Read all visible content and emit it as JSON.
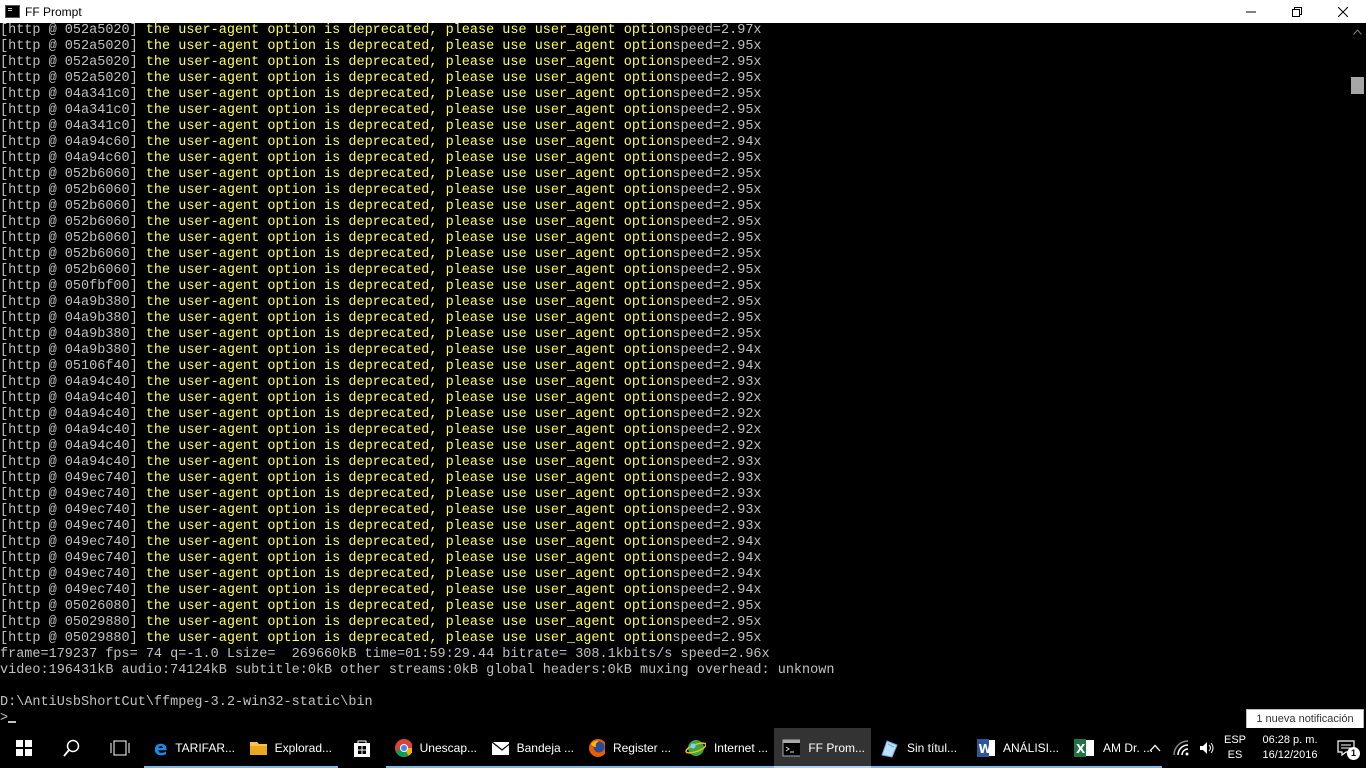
{
  "window": {
    "title": "FF Prompt",
    "controls": {
      "minimize": "1",
      "restore": "❐",
      "close": "✕"
    }
  },
  "console": {
    "log_lines": [
      {
        "addr": "[http @ 052a5020] ",
        "msg": "the user-agent option is deprecated, please use user_agent option",
        "speed": "speed=2.97x"
      },
      {
        "addr": "[http @ 052a5020] ",
        "msg": "the user-agent option is deprecated, please use user_agent option",
        "speed": "speed=2.95x"
      },
      {
        "addr": "[http @ 052a5020] ",
        "msg": "the user-agent option is deprecated, please use user_agent option",
        "speed": "speed=2.95x"
      },
      {
        "addr": "[http @ 052a5020] ",
        "msg": "the user-agent option is deprecated, please use user_agent option",
        "speed": "speed=2.95x"
      },
      {
        "addr": "[http @ 04a341c0] ",
        "msg": "the user-agent option is deprecated, please use user_agent option",
        "speed": "speed=2.95x"
      },
      {
        "addr": "[http @ 04a341c0] ",
        "msg": "the user-agent option is deprecated, please use user_agent option",
        "speed": "speed=2.95x"
      },
      {
        "addr": "[http @ 04a341c0] ",
        "msg": "the user-agent option is deprecated, please use user_agent option",
        "speed": "speed=2.95x"
      },
      {
        "addr": "[http @ 04a94c60] ",
        "msg": "the user-agent option is deprecated, please use user_agent option",
        "speed": "speed=2.94x"
      },
      {
        "addr": "[http @ 04a94c60] ",
        "msg": "the user-agent option is deprecated, please use user_agent option",
        "speed": "speed=2.95x"
      },
      {
        "addr": "[http @ 052b6060] ",
        "msg": "the user-agent option is deprecated, please use user_agent option",
        "speed": "speed=2.95x"
      },
      {
        "addr": "[http @ 052b6060] ",
        "msg": "the user-agent option is deprecated, please use user_agent option",
        "speed": "speed=2.95x"
      },
      {
        "addr": "[http @ 052b6060] ",
        "msg": "the user-agent option is deprecated, please use user_agent option",
        "speed": "speed=2.95x"
      },
      {
        "addr": "[http @ 052b6060] ",
        "msg": "the user-agent option is deprecated, please use user_agent option",
        "speed": "speed=2.95x"
      },
      {
        "addr": "[http @ 052b6060] ",
        "msg": "the user-agent option is deprecated, please use user_agent option",
        "speed": "speed=2.95x"
      },
      {
        "addr": "[http @ 052b6060] ",
        "msg": "the user-agent option is deprecated, please use user_agent option",
        "speed": "speed=2.95x"
      },
      {
        "addr": "[http @ 052b6060] ",
        "msg": "the user-agent option is deprecated, please use user_agent option",
        "speed": "speed=2.95x"
      },
      {
        "addr": "[http @ 050fbf00] ",
        "msg": "the user-agent option is deprecated, please use user_agent option",
        "speed": "speed=2.95x"
      },
      {
        "addr": "[http @ 04a9b380] ",
        "msg": "the user-agent option is deprecated, please use user_agent option",
        "speed": "speed=2.95x"
      },
      {
        "addr": "[http @ 04a9b380] ",
        "msg": "the user-agent option is deprecated, please use user_agent option",
        "speed": "speed=2.95x"
      },
      {
        "addr": "[http @ 04a9b380] ",
        "msg": "the user-agent option is deprecated, please use user_agent option",
        "speed": "speed=2.95x"
      },
      {
        "addr": "[http @ 04a9b380] ",
        "msg": "the user-agent option is deprecated, please use user_agent option",
        "speed": "speed=2.94x"
      },
      {
        "addr": "[http @ 05106f40] ",
        "msg": "the user-agent option is deprecated, please use user_agent option",
        "speed": "speed=2.94x"
      },
      {
        "addr": "[http @ 04a94c40] ",
        "msg": "the user-agent option is deprecated, please use user_agent option",
        "speed": "speed=2.93x"
      },
      {
        "addr": "[http @ 04a94c40] ",
        "msg": "the user-agent option is deprecated, please use user_agent option",
        "speed": "speed=2.92x"
      },
      {
        "addr": "[http @ 04a94c40] ",
        "msg": "the user-agent option is deprecated, please use user_agent option",
        "speed": "speed=2.92x"
      },
      {
        "addr": "[http @ 04a94c40] ",
        "msg": "the user-agent option is deprecated, please use user_agent option",
        "speed": "speed=2.92x"
      },
      {
        "addr": "[http @ 04a94c40] ",
        "msg": "the user-agent option is deprecated, please use user_agent option",
        "speed": "speed=2.92x"
      },
      {
        "addr": "[http @ 04a94c40] ",
        "msg": "the user-agent option is deprecated, please use user_agent option",
        "speed": "speed=2.93x"
      },
      {
        "addr": "[http @ 049ec740] ",
        "msg": "the user-agent option is deprecated, please use user_agent option",
        "speed": "speed=2.93x"
      },
      {
        "addr": "[http @ 049ec740] ",
        "msg": "the user-agent option is deprecated, please use user_agent option",
        "speed": "speed=2.93x"
      },
      {
        "addr": "[http @ 049ec740] ",
        "msg": "the user-agent option is deprecated, please use user_agent option",
        "speed": "speed=2.93x"
      },
      {
        "addr": "[http @ 049ec740] ",
        "msg": "the user-agent option is deprecated, please use user_agent option",
        "speed": "speed=2.93x"
      },
      {
        "addr": "[http @ 049ec740] ",
        "msg": "the user-agent option is deprecated, please use user_agent option",
        "speed": "speed=2.94x"
      },
      {
        "addr": "[http @ 049ec740] ",
        "msg": "the user-agent option is deprecated, please use user_agent option",
        "speed": "speed=2.94x"
      },
      {
        "addr": "[http @ 049ec740] ",
        "msg": "the user-agent option is deprecated, please use user_agent option",
        "speed": "speed=2.94x"
      },
      {
        "addr": "[http @ 049ec740] ",
        "msg": "the user-agent option is deprecated, please use user_agent option",
        "speed": "speed=2.94x"
      },
      {
        "addr": "[http @ 05026080] ",
        "msg": "the user-agent option is deprecated, please use user_agent option",
        "speed": "speed=2.95x"
      },
      {
        "addr": "[http @ 05029880] ",
        "msg": "the user-agent option is deprecated, please use user_agent option",
        "speed": "speed=2.95x"
      },
      {
        "addr": "[http @ 05029880] ",
        "msg": "the user-agent option is deprecated, please use user_agent option",
        "speed": "speed=2.95x"
      }
    ],
    "summary_lines": [
      "frame=179237 fps= 74 q=-1.0 Lsize=  269660kB time=01:59:29.44 bitrate= 308.1kbits/s speed=2.96x",
      "video:196431kB audio:74124kB subtitle:0kB other streams:0kB global headers:0kB muxing overhead: unknown"
    ],
    "prompt_path": "D:\\AntiUsbShortCut\\ffmpeg-3.2-win32-static\\bin",
    "prompt_symbol": ">",
    "colors": {
      "message": "#ffff55",
      "default": "#c0c0c0"
    }
  },
  "toast": "1 nueva notificación",
  "taskbar": {
    "apps": [
      {
        "label": "TARIFAR...",
        "icon": "edge-icon"
      },
      {
        "label": "Explorad...",
        "icon": "folder-icon"
      },
      {
        "label": "",
        "icon": "store-icon"
      },
      {
        "label": "Unescap...",
        "icon": "chrome-icon"
      },
      {
        "label": "Bandeja ...",
        "icon": "mail-icon"
      },
      {
        "label": "Register ...",
        "icon": "firefox-icon"
      },
      {
        "label": "Internet ...",
        "icon": "internet-icon"
      },
      {
        "label": "FF Prom...",
        "icon": "terminal-icon",
        "active": true
      },
      {
        "label": "Sin títul...",
        "icon": "paint-icon"
      },
      {
        "label": "ANÁLISI...",
        "icon": "word-icon"
      },
      {
        "label": "AM Dr. ...",
        "icon": "excel-icon"
      }
    ],
    "tray": {
      "lang_top": "ESP",
      "lang_bottom": "ES",
      "time": "06:28 p. m.",
      "date": "16/12/2016",
      "notification_count": "1"
    }
  }
}
